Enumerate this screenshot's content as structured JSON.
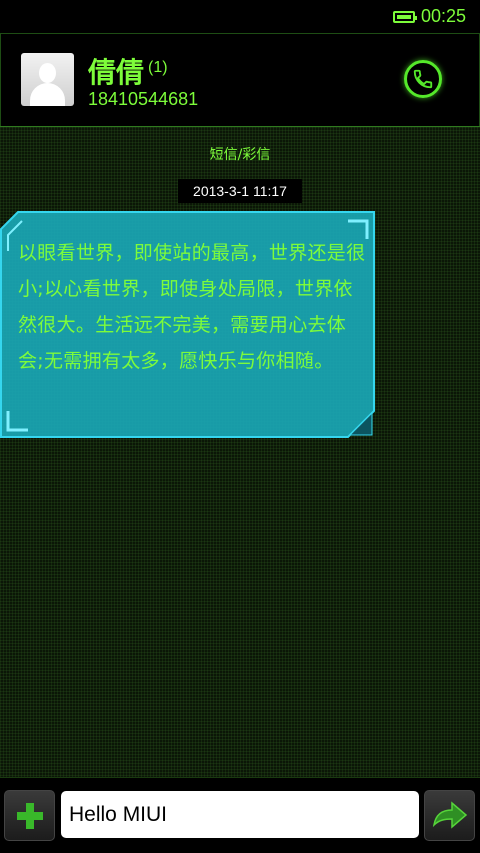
{
  "status_bar": {
    "time": "00:25",
    "battery_icon": "battery-full-icon"
  },
  "header": {
    "contact_name": "倩倩",
    "message_count": "(1)",
    "phone_number": "18410544681",
    "avatar_icon": "default-avatar-icon",
    "call_icon": "phone-icon"
  },
  "conversation": {
    "message_type_label": "短信/彩信",
    "messages": [
      {
        "timestamp": "2013-3-1 11:17",
        "text": "以眼看世界，即使站的最高，世界还是很小;以心看世界，即使身处局限，世界依然很大。生活远不完美，需要用心去体会;无需拥有太多，愿快乐与你相随。"
      }
    ]
  },
  "input_bar": {
    "add_icon": "plus-icon",
    "message_value": "Hello MIUI",
    "send_icon": "send-arrow-icon"
  },
  "colors": {
    "accent": "#7dfc3a",
    "bubble_fill": "#1aa7b5",
    "bubble_border": "#35d6ee",
    "background": "#0b1607"
  }
}
